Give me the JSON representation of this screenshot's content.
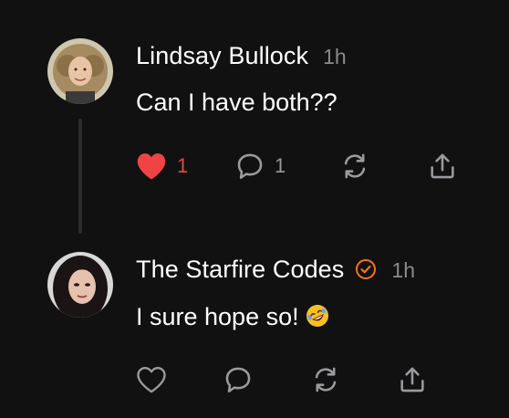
{
  "colors": {
    "background": "#111111",
    "text": "#ffffff",
    "muted": "#8a8a8f",
    "like_active": "#ef4444",
    "verified_badge": "#f97316",
    "icon": "#9a9a9f"
  },
  "posts": [
    {
      "author": "Lindsay Bullock",
      "time": "1h",
      "text": "Can I have both??",
      "liked": true,
      "like_count": "1",
      "reply_count": "1",
      "icons": [
        "heart-filled-icon",
        "comment-icon",
        "repost-icon",
        "share-icon"
      ]
    },
    {
      "author": "The Starfire Codes",
      "verified": true,
      "time": "1h",
      "text": "I sure hope so!",
      "emoji": "rolling-on-the-floor-laughing",
      "liked": false,
      "icons": [
        "heart-outline-icon",
        "comment-icon",
        "repost-icon",
        "share-icon"
      ]
    }
  ]
}
